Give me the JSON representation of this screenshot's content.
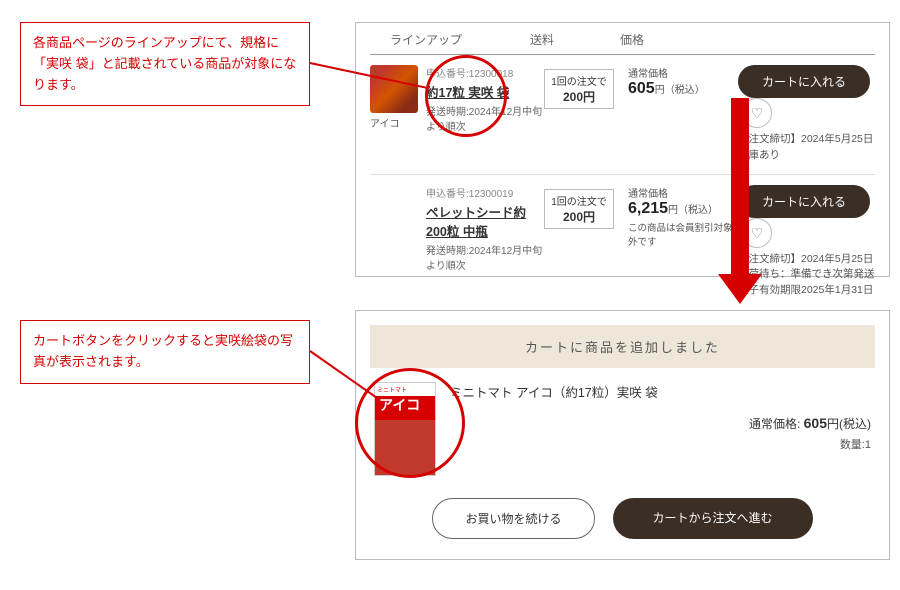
{
  "callouts": {
    "c1": "各商品ページのラインアップにて、規格に「実咲 袋」と記載されている商品が対象になります。",
    "c2": "カートボタンをクリックすると実咲絵袋の写真が表示されます。"
  },
  "table": {
    "head": {
      "lineup": "ラインアップ",
      "ship": "送料",
      "price": "価格"
    },
    "rows": [
      {
        "order_no_label": "申込番号:12300018",
        "name": "約17粒 実咲 袋",
        "ship_line": "発送時期:2024年12月中旬より順次",
        "thumb_caption": "アイコ",
        "ship_box_top": "1回の注文で",
        "ship_box_val": "200円",
        "price_label": "通常価格",
        "price_value": "605",
        "price_unit": "円（税込）",
        "cart_label": "カートに入れる",
        "deadline": "【注文締切】2024年5月25日",
        "stock": "在庫あり"
      },
      {
        "order_no_label": "申込番号:12300019",
        "name": "ペレットシード約200粒 中瓶",
        "ship_line": "発送時期:2024年12月中旬より順次",
        "ship_box_top": "1回の注文で",
        "ship_box_val": "200円",
        "price_label": "通常価格",
        "price_value": "6,215",
        "price_unit": "円（税込）",
        "price_note": "この商品は会員割引対象外です",
        "cart_label": "カートに入れる",
        "deadline": "【注文締切】2024年5月25日",
        "stock": "入荷待ち：準備でき次第発送",
        "extra": "種子有効期限2025年1月31日"
      }
    ]
  },
  "cart": {
    "banner": "カートに商品を追加しました",
    "pkg_top": "ミニトマト",
    "pkg_brand": "アイコ",
    "item_name": "ミニトマト アイコ（約17粒）実咲 袋",
    "price_label": "通常価格: ",
    "price_value": "605",
    "price_unit": "円(税込)",
    "qty_label": "数量:",
    "qty_value": "1",
    "continue": "お買い物を続ける",
    "proceed": "カートから注文へ進む"
  }
}
